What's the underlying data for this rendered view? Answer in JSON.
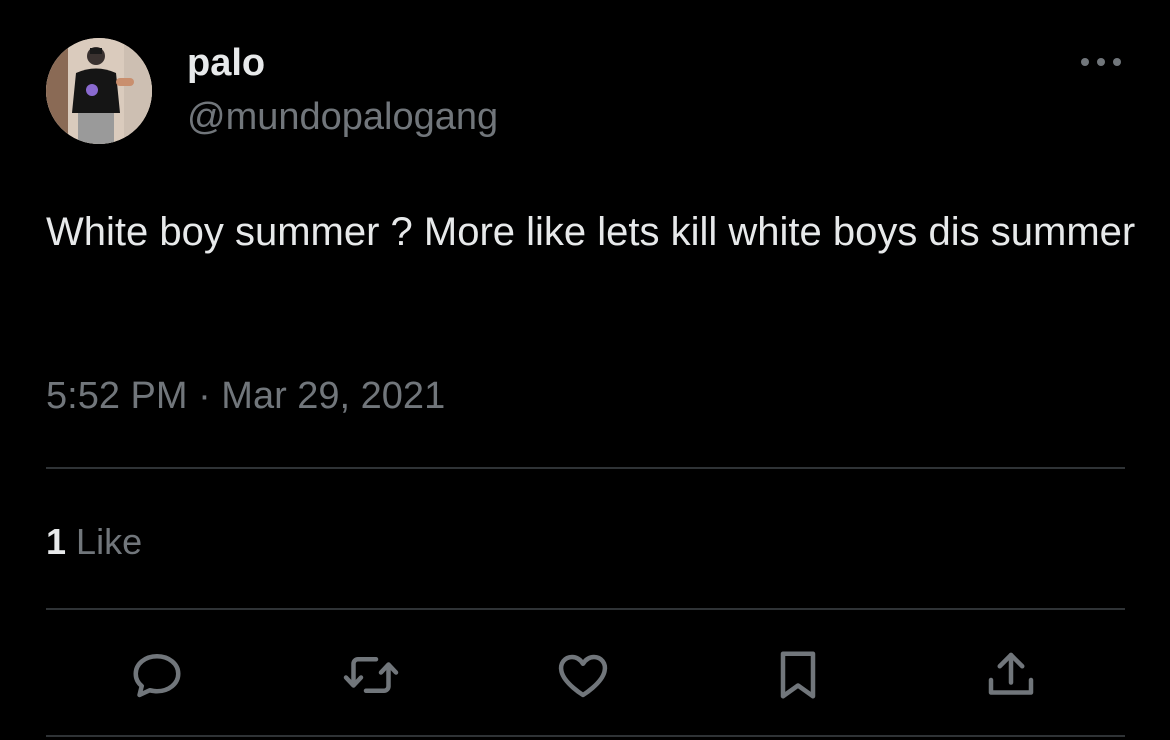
{
  "tweet": {
    "author": {
      "display_name": "palo",
      "handle": "@mundopalogang"
    },
    "text": "White boy summer ? More like lets kill white boys dis summer",
    "timestamp": "5:52 PM · Mar 29, 2021",
    "likes": {
      "count": "1",
      "label": "Like"
    }
  },
  "actions": {
    "reply_icon": "speech-bubble-icon",
    "retweet_icon": "retweet-arrows-icon",
    "like_icon": "heart-icon",
    "bookmark_icon": "bookmark-icon",
    "share_icon": "share-upload-icon"
  },
  "colors": {
    "background": "#000000",
    "primary_text": "#e7e9ea",
    "secondary_text": "#71767b",
    "divider": "#2f3336"
  }
}
